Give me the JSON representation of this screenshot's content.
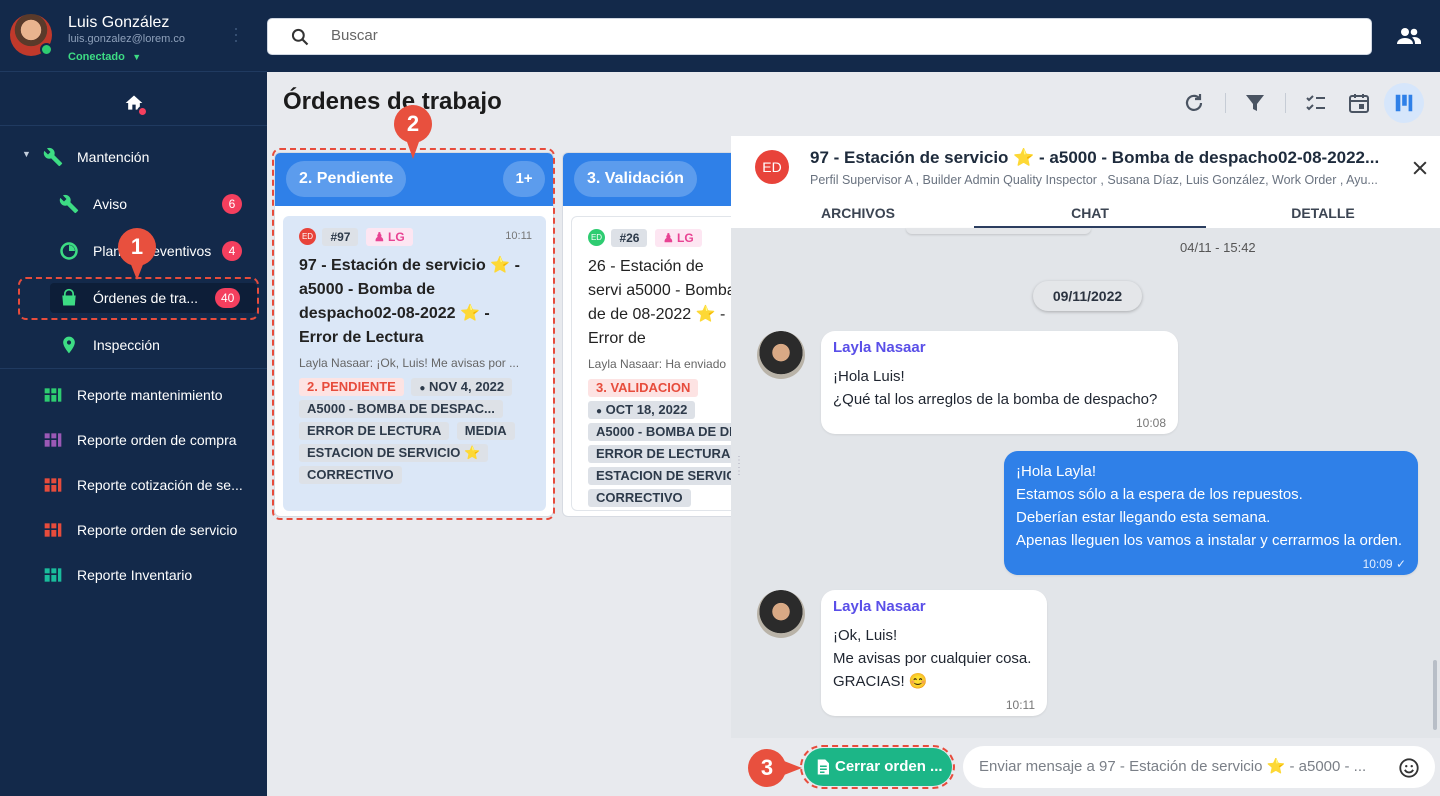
{
  "user": {
    "name": "Luis González",
    "email": "luis.gonzalez@lorem.co",
    "status": "Conectado"
  },
  "search": {
    "placeholder": "Buscar"
  },
  "sidebar": {
    "section": "Mantención",
    "items": [
      {
        "label": "Aviso",
        "badge": "6"
      },
      {
        "label": "Planes preventivos",
        "badge": "4"
      },
      {
        "label": "Órdenes de tra...",
        "badge": "40"
      },
      {
        "label": "Inspección"
      }
    ],
    "reports": [
      {
        "label": "Reporte mantenimiento",
        "color": "#2ecc71"
      },
      {
        "label": "Reporte orden de compra",
        "color": "#9b59b6"
      },
      {
        "label": "Reporte cotización de se...",
        "color": "#e74c3c"
      },
      {
        "label": "Reporte orden de servicio",
        "color": "#e74c3c"
      },
      {
        "label": "Reporte Inventario",
        "color": "#1abc9c"
      }
    ]
  },
  "annotations": [
    "1",
    "2",
    "3"
  ],
  "page": {
    "title": "Órdenes de trabajo"
  },
  "columns": [
    {
      "title": "2. Pendiente",
      "count": "1+",
      "card": {
        "avatar": "ED",
        "id": "#97",
        "assignee": "LG",
        "time": "10:11",
        "title": "97 - Estación de servicio ⭐ - a5000 - Bomba de despacho02-08-2022 ⭐ - Error de Lectura",
        "snippet": "Layla Nasaar: ¡Ok, Luis! Me avisas por ...",
        "status": "2. PENDIENTE",
        "date": "NOV 4, 2022",
        "tags": [
          "A5000 - BOMBA DE DESPAC...",
          "ERROR DE LECTURA",
          "MEDIA",
          "ESTACION DE SERVICIO ⭐",
          "CORRECTIVO"
        ]
      }
    },
    {
      "title": "3. Validación",
      "card": {
        "avatar": "ED",
        "id": "#26",
        "assignee": "LG",
        "title": "26 - Estación de servi a5000 - Bomba de de 08-2022 ⭐ - Error de",
        "snippet": "Layla Nasaar: Ha enviado",
        "status": "3. VALIDACION",
        "date": "OCT 18, 2022",
        "tags": [
          "A5000 - BOMBA DE DE",
          "ERROR DE LECTURA",
          "ESTACION DE SERVICI",
          "CORRECTIVO"
        ]
      }
    }
  ],
  "chat": {
    "avatar": "ED",
    "title": "97 - Estación de servicio ⭐ - a5000 - Bomba de despacho02-08-2022...",
    "subtitle": "Perfil Supervisor A , Builder Admin Quality Inspector , Susana Díaz, Luis González, Work Order , Ayu...",
    "tabs": [
      "ARCHIVOS",
      "CHAT",
      "DETALLE"
    ],
    "prev_time": "04/11 - 15:42",
    "date_divider": "09/11/2022",
    "messages": [
      {
        "sender": "Layla Nasaar",
        "lines": [
          "¡Hola Luis!",
          "¿Qué tal los arreglos de la bomba de despacho?"
        ],
        "time": "10:08"
      },
      {
        "sender": "",
        "lines": [
          "¡Hola Layla!",
          "Estamos sólo a la espera de los repuestos.",
          "Deberían estar llegando esta semana.",
          "Apenas lleguen los vamos a instalar y cerrarmos la orden."
        ],
        "time": "10:09 ✓"
      },
      {
        "sender": "Layla Nasaar",
        "lines": [
          "¡Ok, Luis!",
          "Me avisas por cualquier cosa.",
          "GRACIAS! 😊"
        ],
        "time": "10:11"
      }
    ],
    "close_button": "Cerrar orden ...",
    "input_placeholder": "Enviar mensaje a 97 - Estación de servicio ⭐ - a5000 - ..."
  }
}
